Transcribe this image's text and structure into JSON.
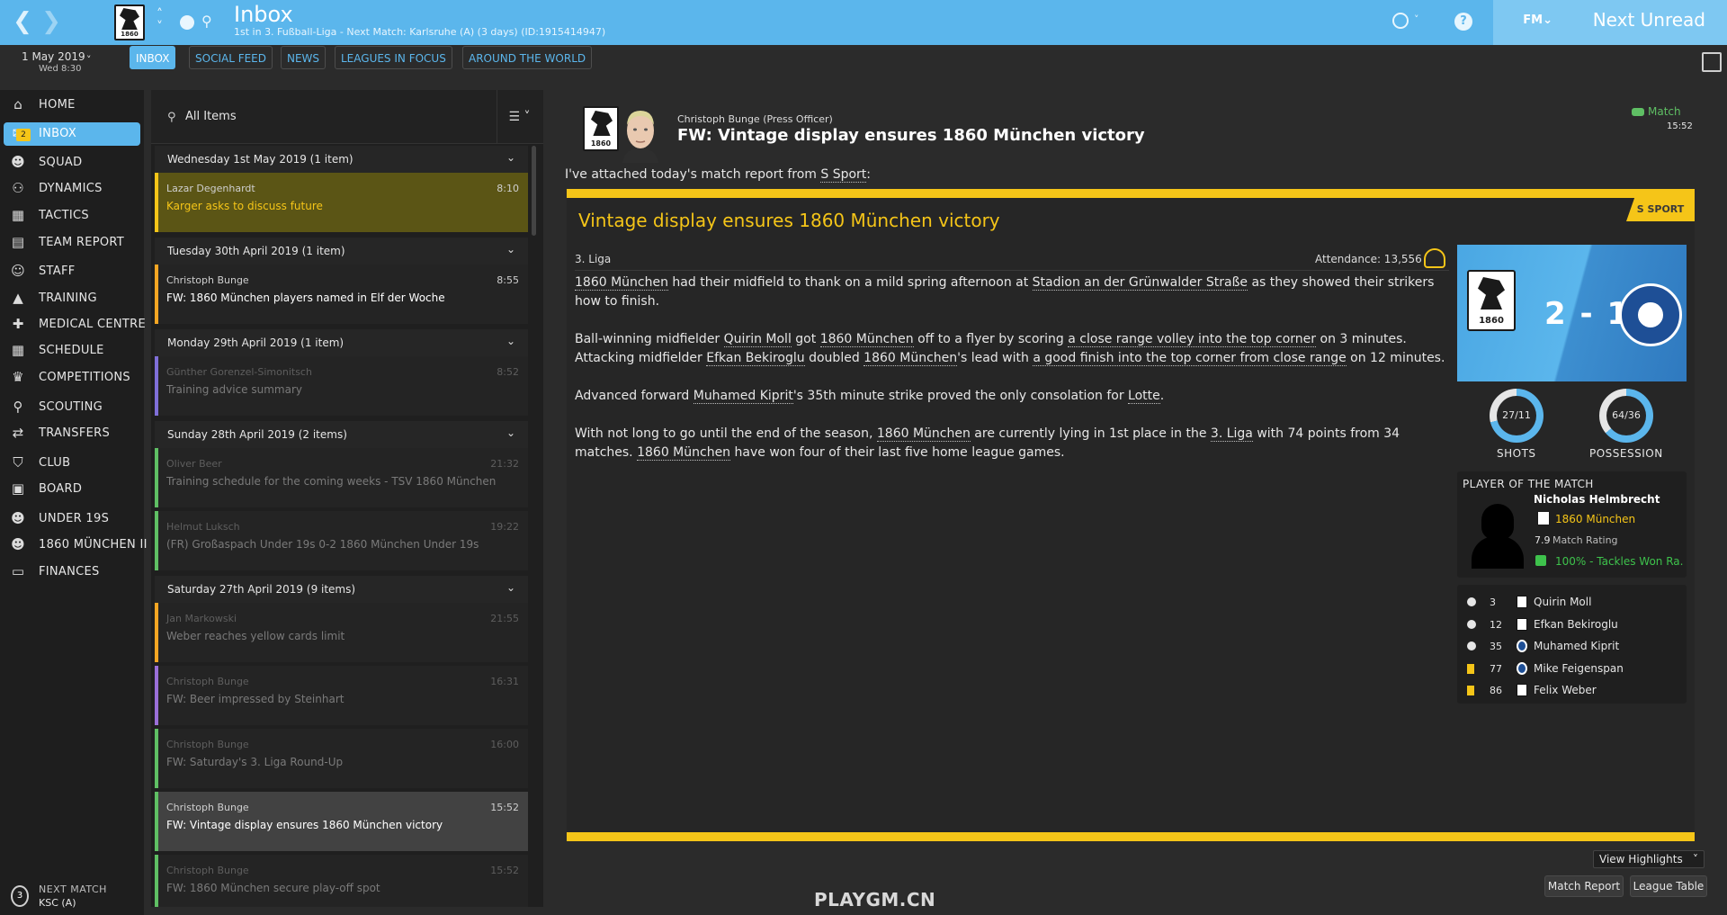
{
  "header": {
    "title": "Inbox",
    "subtitle": "1st in 3. Fußball-Liga - Next Match: Karlsruhe (A) (3 days) (ID:1915414947)",
    "fm_menu": "FM⌄",
    "next_unread": "Next Unread",
    "help": "?",
    "crest_year": "1860"
  },
  "date": {
    "line1": "1 May 2019",
    "line2": "Wed 8:30"
  },
  "tabs": [
    "INBOX",
    "SOCIAL FEED",
    "NEWS",
    "LEAGUES IN FOCUS",
    "AROUND THE WORLD"
  ],
  "sidebar": {
    "inbox_badge": "2",
    "items": [
      {
        "label": "HOME",
        "icon": "home-icon"
      },
      {
        "label": "INBOX",
        "icon": "inbox-icon"
      },
      {
        "label": "SQUAD",
        "icon": "squad-icon"
      },
      {
        "label": "DYNAMICS",
        "icon": "dynamics-icon"
      },
      {
        "label": "TACTICS",
        "icon": "tactics-icon"
      },
      {
        "label": "TEAM REPORT",
        "icon": "report-icon"
      },
      {
        "label": "STAFF",
        "icon": "staff-icon"
      },
      {
        "label": "TRAINING",
        "icon": "training-icon"
      },
      {
        "label": "MEDICAL CENTRE",
        "icon": "medical-icon"
      },
      {
        "label": "SCHEDULE",
        "icon": "calendar-icon"
      },
      {
        "label": "COMPETITIONS",
        "icon": "trophy-icon"
      },
      {
        "label": "SCOUTING",
        "icon": "search-icon"
      },
      {
        "label": "TRANSFERS",
        "icon": "transfers-icon"
      },
      {
        "label": "CLUB",
        "icon": "shield-icon"
      },
      {
        "label": "BOARD",
        "icon": "briefcase-icon"
      },
      {
        "label": "UNDER 19S",
        "icon": "youth-icon"
      },
      {
        "label": "1860 MÜNCHEN II",
        "icon": "reserve-icon"
      },
      {
        "label": "FINANCES",
        "icon": "money-icon"
      }
    ],
    "next_match_label": "NEXT MATCH",
    "next_match_value": "KSC (A)",
    "next_match_days": "3"
  },
  "list": {
    "search_label": "All Items",
    "days": [
      {
        "label": "Wednesday 1st May 2019 (1 item)"
      },
      {
        "label": "Tuesday 30th April 2019 (1 item)"
      },
      {
        "label": "Monday 29th April 2019 (1 item)"
      },
      {
        "label": "Sunday 28th April 2019 (2 items)"
      },
      {
        "label": "Saturday 27th April 2019 (9 items)"
      }
    ],
    "messages": [
      {
        "sender": "Lazar Degenhardt",
        "subject": "Karger asks to discuss future",
        "time": "8:10"
      },
      {
        "sender": "Christoph Bunge",
        "subject": "FW: 1860 München players named in Elf der Woche",
        "time": "8:55"
      },
      {
        "sender": "Günther Gorenzel-Simonitsch",
        "subject": "Training advice summary",
        "time": "8:52"
      },
      {
        "sender": "Oliver Beer",
        "subject": "Training schedule for the coming weeks - TSV 1860 München",
        "time": "21:32"
      },
      {
        "sender": "Helmut Luksch",
        "subject": "(FR) Großaspach Under 19s 0-2 1860 München Under 19s",
        "time": "19:22"
      },
      {
        "sender": "Jan Markowski",
        "subject": "Weber reaches yellow cards limit",
        "time": "21:55"
      },
      {
        "sender": "Christoph Bunge",
        "subject": "FW: Beer impressed by Steinhart",
        "time": "16:31"
      },
      {
        "sender": "Christoph Bunge",
        "subject": "FW: Saturday's 3. Liga Round-Up",
        "time": "16:00"
      },
      {
        "sender": "Christoph Bunge",
        "subject": "FW: Vintage display ensures 1860 München victory",
        "time": "15:52"
      },
      {
        "sender": "Christoph Bunge",
        "subject": "FW: 1860 München secure play-off spot",
        "time": "15:52"
      }
    ]
  },
  "message": {
    "from": "Christoph Bunge  (Press Officer)",
    "subject": "FW: Vintage display ensures 1860 München victory",
    "tag": "Match",
    "time": "15:52",
    "intro_pre": "I've attached today's match report from ",
    "intro_link": "S Sport",
    "intro_post": ":"
  },
  "report": {
    "source_badge": "S SPORT",
    "title": "Vintage display ensures 1860 München victory",
    "competition": "3. Liga",
    "attendance": "Attendance: 13,556",
    "p1": [
      {
        "t": "1860 München",
        "u": true
      },
      {
        "t": " had their midfield to thank on a mild spring afternoon at "
      },
      {
        "t": "Stadion an der Grünwalder Straße",
        "u": true
      },
      {
        "t": " as they showed their strikers how to finish."
      }
    ],
    "p2": [
      {
        "t": "Ball-winning midfielder "
      },
      {
        "t": "Quirin Moll",
        "u": true
      },
      {
        "t": " got "
      },
      {
        "t": "1860 München",
        "u": true
      },
      {
        "t": " off to a flyer by scoring "
      },
      {
        "t": "a close range volley into the top corner",
        "u": true
      },
      {
        "t": " on 3 minutes. Attacking midfielder "
      },
      {
        "t": "Efkan Bekiroglu",
        "u": true
      },
      {
        "t": " doubled "
      },
      {
        "t": "1860 München",
        "u": true
      },
      {
        "t": "'s lead with "
      },
      {
        "t": "a good finish into the top corner from close range",
        "u": true
      },
      {
        "t": " on 12 minutes."
      }
    ],
    "p3": [
      {
        "t": "Advanced forward "
      },
      {
        "t": "Muhamed Kiprit",
        "u": true
      },
      {
        "t": "'s 35th minute strike proved the only consolation for "
      },
      {
        "t": "Lotte",
        "u": true
      },
      {
        "t": "."
      }
    ],
    "p4": [
      {
        "t": "With not long to go until the end of the season, "
      },
      {
        "t": "1860 München",
        "u": true
      },
      {
        "t": " are currently lying in 1st place in the "
      },
      {
        "t": "3. Liga",
        "u": true
      },
      {
        "t": " with 74 points from 34 matches. "
      },
      {
        "t": "1860 München",
        "u": true
      },
      {
        "t": " have won four of their last five home league games."
      }
    ],
    "score": "2 - 1",
    "shots": {
      "label": "SHOTS",
      "value": "27/11",
      "fraction": 0.71
    },
    "possession": {
      "label": "POSSESSION",
      "value": "64/36",
      "fraction": 0.64
    },
    "potm": {
      "label": "PLAYER OF THE MATCH",
      "name": "Nicholas Helmbrecht",
      "club": "1860 München",
      "rating": "7.9",
      "rating_label": "Match Rating",
      "stat": "100% - Tackles Won Ra..."
    },
    "events": [
      {
        "type": "goal",
        "minute": "3",
        "team": "home",
        "player": "Quirin Moll"
      },
      {
        "type": "goal",
        "minute": "12",
        "team": "home",
        "player": "Efkan Bekiroglu"
      },
      {
        "type": "goal",
        "minute": "35",
        "team": "away",
        "player": "Muhamed Kiprit"
      },
      {
        "type": "yellow",
        "minute": "77",
        "team": "away",
        "player": "Mike Feigenspan"
      },
      {
        "type": "yellow",
        "minute": "86",
        "team": "home",
        "player": "Felix Weber"
      }
    ]
  },
  "footer": {
    "view_highlights": "View Highlights",
    "match_report": "Match Report",
    "league_table": "League Table",
    "watermark": "PLAYGM.CN"
  },
  "colors": {
    "accent": "#5bb6ec",
    "highlight": "#f5c518",
    "positive": "#3ec24c"
  }
}
